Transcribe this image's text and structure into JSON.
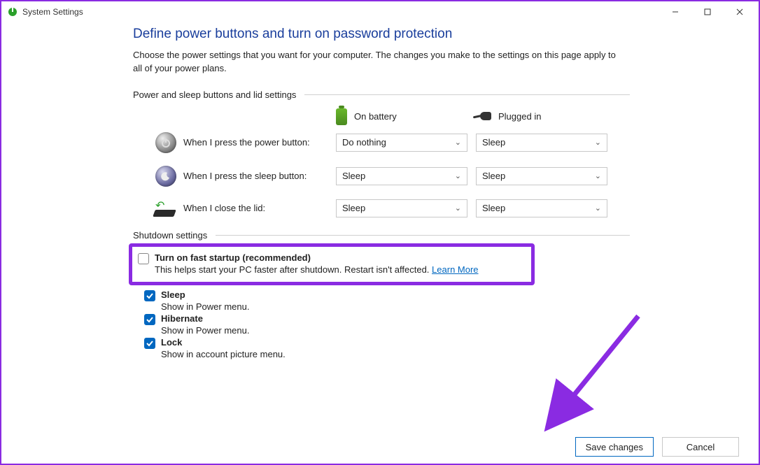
{
  "window": {
    "title": "System Settings"
  },
  "heading": "Define power buttons and turn on password protection",
  "subtitle": "Choose the power settings that you want for your computer. The changes you make to the settings on this page apply to all of your power plans.",
  "section1_label": "Power and sleep buttons and lid settings",
  "columns": {
    "battery": "On battery",
    "plugged": "Plugged in"
  },
  "rows": [
    {
      "label": "When I press the power button:",
      "battery": "Do nothing",
      "plugged": "Sleep"
    },
    {
      "label": "When I press the sleep button:",
      "battery": "Sleep",
      "plugged": "Sleep"
    },
    {
      "label": "When I close the lid:",
      "battery": "Sleep",
      "plugged": "Sleep"
    }
  ],
  "section2_label": "Shutdown settings",
  "shutdown": {
    "fast": {
      "checked": false,
      "title": "Turn on fast startup (recommended)",
      "desc": "This helps start your PC faster after shutdown. Restart isn't affected.",
      "learn": "Learn More"
    },
    "items": [
      {
        "checked": true,
        "title": "Sleep",
        "desc": "Show in Power menu."
      },
      {
        "checked": true,
        "title": "Hibernate",
        "desc": "Show in Power menu."
      },
      {
        "checked": true,
        "title": "Lock",
        "desc": "Show in account picture menu."
      }
    ]
  },
  "buttons": {
    "save": "Save changes",
    "cancel": "Cancel"
  }
}
